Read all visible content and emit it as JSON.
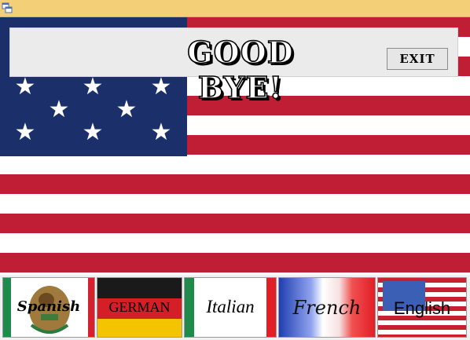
{
  "window": {
    "icon": "app-window-icon"
  },
  "banner": {
    "message": "GOOD BYE!"
  },
  "toolbar": {
    "exit_label": "EXIT"
  },
  "languages": [
    {
      "label": "Spanish",
      "flag": "mexico-flag"
    },
    {
      "label": "GERMAN",
      "flag": "germany-flag"
    },
    {
      "label": "Italian",
      "flag": "italy-flag"
    },
    {
      "label": "French",
      "flag": "france-flag"
    },
    {
      "label": "English",
      "flag": "usa-flag"
    }
  ],
  "colors": {
    "titlebar": "#f3cf78",
    "flag_red": "#bf1e35",
    "flag_blue": "#1b2f6a"
  }
}
